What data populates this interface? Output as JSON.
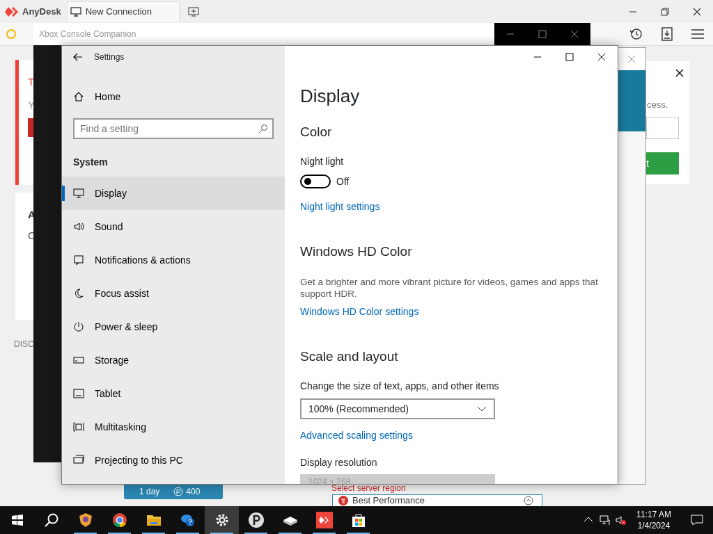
{
  "anydesk": {
    "app_name": "AnyDesk",
    "tabs": [
      {
        "label": "New Connection",
        "selected": true
      }
    ]
  },
  "background": {
    "alert_card": {
      "title": "T",
      "text": "Y"
    },
    "info_card": {
      "title": "A",
      "text": "C"
    },
    "section_label": "DISC",
    "access_card": {
      "text": "cess.",
      "button": "t"
    },
    "plan": {
      "duration": "1 day",
      "price": "400"
    },
    "server_region": {
      "label": "Select server region",
      "value": "Best Performance"
    }
  },
  "xbox_window": {
    "title": "Xbox Console Companion"
  },
  "settings": {
    "title": "Settings",
    "home": "Home",
    "search": {
      "placeholder": "Find a setting"
    },
    "section": "System",
    "nav": [
      {
        "label": "Display",
        "selected": true
      },
      {
        "label": "Sound",
        "selected": false
      },
      {
        "label": "Notifications & actions",
        "selected": false
      },
      {
        "label": "Focus assist",
        "selected": false
      },
      {
        "label": "Power & sleep",
        "selected": false
      },
      {
        "label": "Storage",
        "selected": false
      },
      {
        "label": "Tablet",
        "selected": false
      },
      {
        "label": "Multitasking",
        "selected": false
      },
      {
        "label": "Projecting to this PC",
        "selected": false
      }
    ],
    "content": [
      {
        "kind": "title",
        "text": "Display"
      },
      {
        "kind": "heading",
        "text": "Color"
      },
      {
        "kind": "label",
        "text": "Night light"
      },
      {
        "kind": "toggle",
        "on": false,
        "label": "Off"
      },
      {
        "kind": "link",
        "text": "Night light settings"
      },
      {
        "kind": "heading",
        "text": "Windows HD Color"
      },
      {
        "kind": "text",
        "text": "Get a brighter and more vibrant picture for videos, games and apps that support HDR."
      },
      {
        "kind": "link",
        "text": "Windows HD Color settings"
      },
      {
        "kind": "heading",
        "text": "Scale and layout"
      },
      {
        "kind": "label",
        "text": "Change the size of text, apps, and other items"
      },
      {
        "kind": "dropdown",
        "value": "100% (Recommended)",
        "disabled": false
      },
      {
        "kind": "link",
        "text": "Advanced scaling settings"
      },
      {
        "kind": "label",
        "text": "Display resolution"
      },
      {
        "kind": "dropdown",
        "value": "1024 × 768",
        "disabled": true
      }
    ]
  },
  "taskbar": {
    "apps": [
      {
        "running": true,
        "selected": false
      },
      {
        "running": true,
        "selected": false
      },
      {
        "running": true,
        "selected": false
      },
      {
        "running": true,
        "selected": false
      },
      {
        "running": true,
        "selected": true
      },
      {
        "running": true,
        "selected": false
      },
      {
        "running": true,
        "selected": false
      },
      {
        "running": true,
        "selected": false
      },
      {
        "running": true,
        "selected": false
      }
    ],
    "time": "11:17 AM",
    "date": "1/4/2024"
  }
}
